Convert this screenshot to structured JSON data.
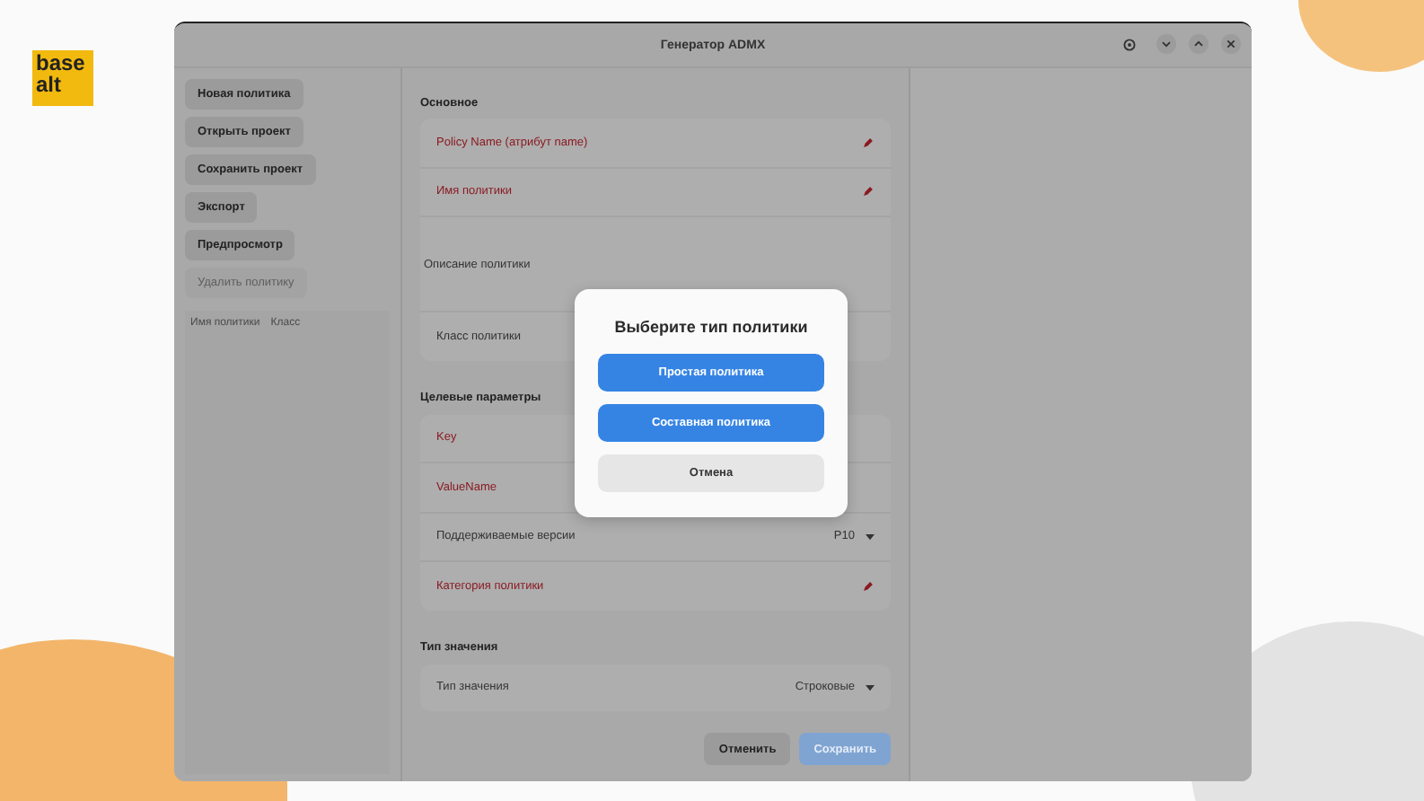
{
  "logo": {
    "lines": [
      "base",
      "alt"
    ]
  },
  "window": {
    "title": "Генератор ADMX"
  },
  "sidebar": {
    "buttons": [
      {
        "label": "Новая политика",
        "disabled": false
      },
      {
        "label": "Открыть проект",
        "disabled": false
      },
      {
        "label": "Сохранить проект",
        "disabled": false
      },
      {
        "label": "Экспорт",
        "disabled": false
      },
      {
        "label": "Предпросмотр",
        "disabled": false
      },
      {
        "label": "Удалить политику",
        "disabled": true
      }
    ],
    "list_columns": [
      "Имя политики",
      "Класс"
    ]
  },
  "sections": [
    {
      "title": "Основное",
      "rows": [
        {
          "label": "Policy Name (атрибут name)",
          "kind": "edit",
          "required": true
        },
        {
          "label": "Имя политики",
          "kind": "edit",
          "required": true
        },
        {
          "label": "Описание политики",
          "kind": "text",
          "required": false
        },
        {
          "label": "Класс политики",
          "kind": "plain",
          "required": false
        }
      ]
    },
    {
      "title": "Целевые параметры",
      "rows": [
        {
          "label": "Key",
          "kind": "plain",
          "required": true
        },
        {
          "label": "ValueName",
          "kind": "plain",
          "required": true
        },
        {
          "label": "Поддерживаемые версии",
          "kind": "dropdown",
          "value": "P10",
          "required": false
        },
        {
          "label": "Категория политики",
          "kind": "edit",
          "required": true
        }
      ]
    },
    {
      "title": "Тип значения",
      "rows": [
        {
          "label": "Тип значения",
          "kind": "dropdown",
          "value": "Строковые",
          "required": false
        }
      ]
    }
  ],
  "footer": [
    {
      "label": "Отменить",
      "kind": "secondary",
      "disabled": false
    },
    {
      "label": "Сохранить",
      "kind": "primary",
      "disabled": true
    }
  ],
  "dialog": {
    "title": "Выберите тип политики",
    "buttons": [
      {
        "label": "Простая политика",
        "kind": "primary"
      },
      {
        "label": "Составная политика",
        "kind": "primary"
      },
      {
        "label": "Отмена",
        "kind": "secondary"
      }
    ]
  }
}
